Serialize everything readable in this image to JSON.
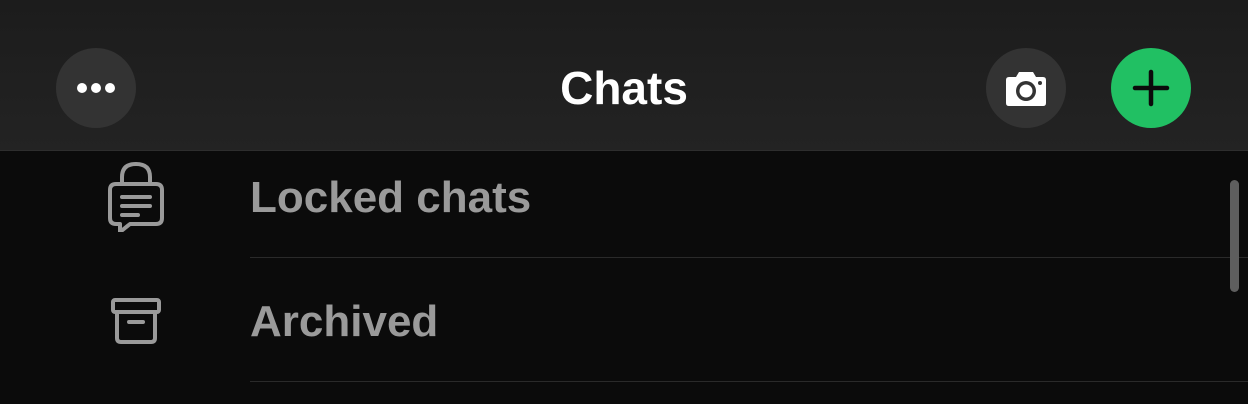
{
  "header": {
    "title": "Chats",
    "more_icon": "ellipsis-icon",
    "camera_icon": "camera-icon",
    "add_icon": "plus-icon",
    "accent_color": "#21c063"
  },
  "list": {
    "items": [
      {
        "label": "Locked chats",
        "icon": "locked-chat-icon"
      },
      {
        "label": "Archived",
        "icon": "archive-box-icon"
      }
    ]
  }
}
